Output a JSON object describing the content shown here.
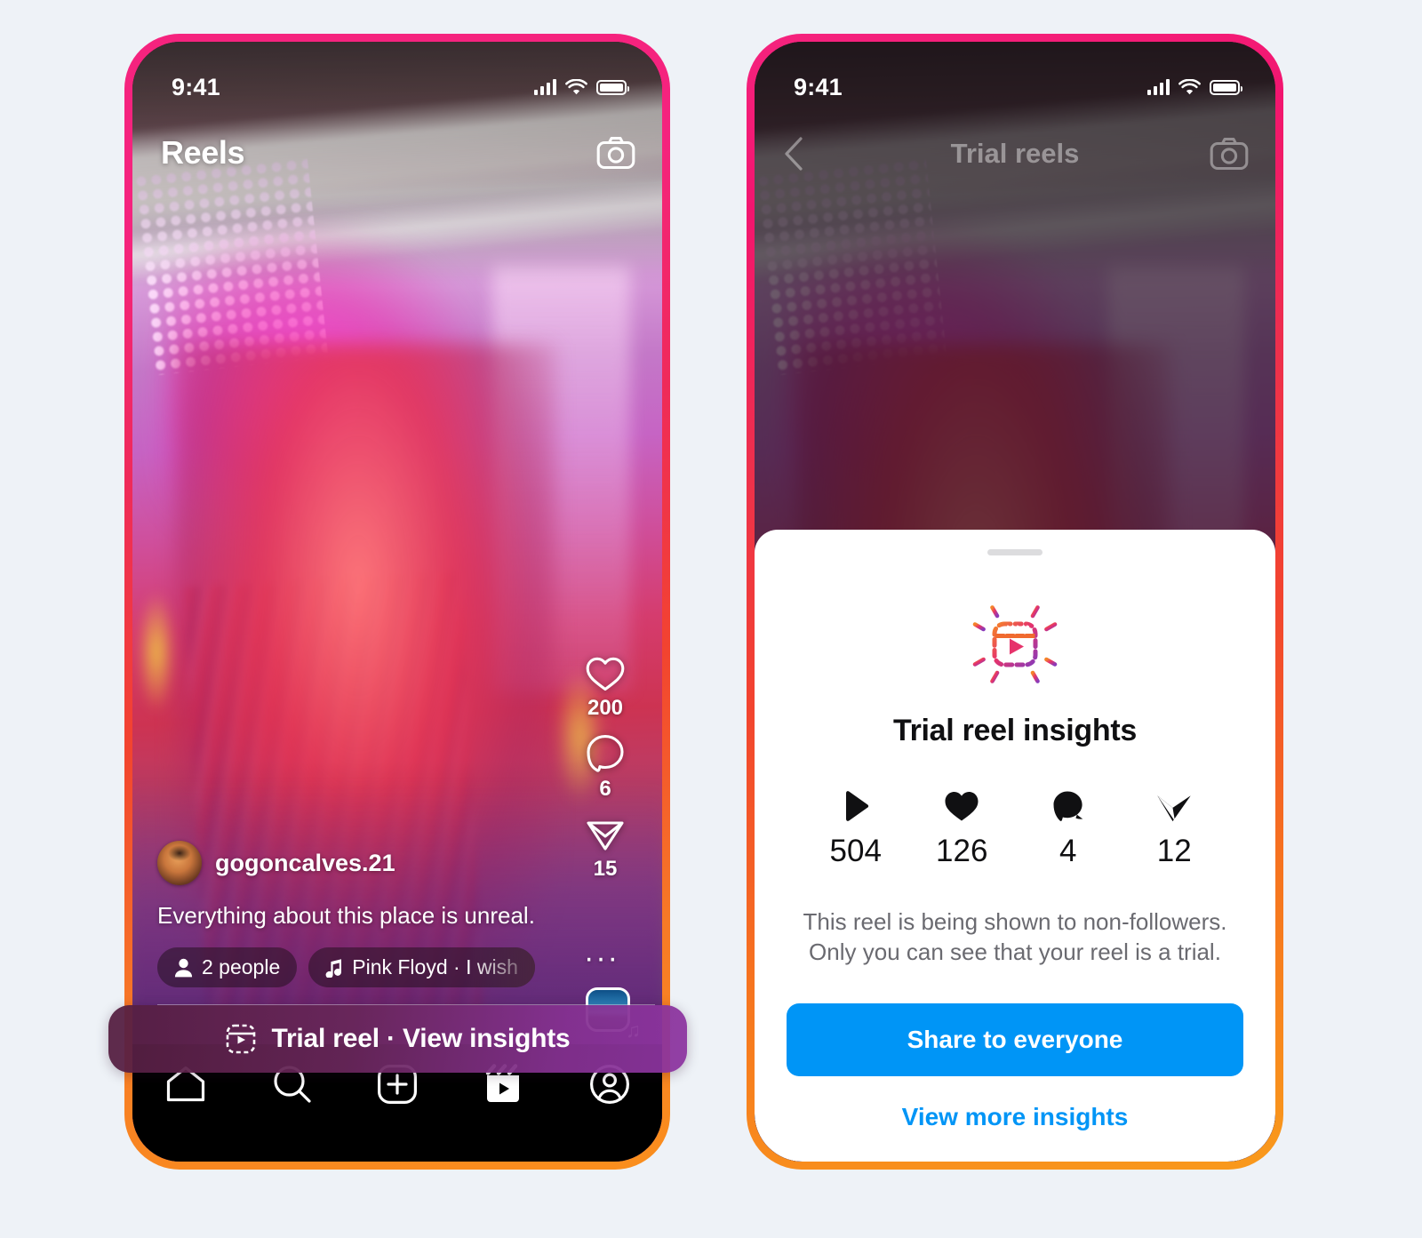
{
  "background_color": "#eef2f7",
  "accent_colors": {
    "instagram_blue": "#0095f6",
    "frame_gradient_top": "#f5237e",
    "frame_gradient_bottom": "#fa8f1d",
    "banner_purple": "#85319 1"
  },
  "phone_a": {
    "status_bar": {
      "time": "9:41",
      "signal_icon": "cellular-signal-icon",
      "wifi_icon": "wifi-icon",
      "battery_icon": "battery-icon"
    },
    "top_bar": {
      "title": "Reels",
      "camera_icon": "camera-icon"
    },
    "action_rail": [
      {
        "icon": "heart-icon",
        "name": "like-button",
        "count": "200"
      },
      {
        "icon": "comment-icon",
        "name": "comment-button",
        "count": "6"
      },
      {
        "icon": "share-icon",
        "name": "share-button",
        "count": "15"
      }
    ],
    "more_options": "···",
    "audio_thumbnail": {
      "icon": "audio-track-thumbnail",
      "note_glyph": "♫"
    },
    "post": {
      "username": "gogoncalves.21",
      "avatar": "user-avatar",
      "caption": "Everything about this place is unreal.",
      "tags": [
        {
          "icon": "person-icon",
          "label": "2 people"
        },
        {
          "icon": "music-note-icon",
          "label": "Pink Floyd · I wish"
        }
      ]
    },
    "trial_banner": {
      "icon": "trial-reel-icon",
      "label": "Trial reel · View insights"
    },
    "tab_bar": [
      {
        "name": "home",
        "icon": "home-icon"
      },
      {
        "name": "search",
        "icon": "search-icon"
      },
      {
        "name": "create",
        "icon": "plus-square-icon"
      },
      {
        "name": "reels",
        "icon": "reels-icon"
      },
      {
        "name": "profile",
        "icon": "profile-icon"
      }
    ]
  },
  "phone_b": {
    "status_bar": {
      "time": "9:41",
      "signal_icon": "cellular-signal-icon",
      "wifi_icon": "wifi-icon",
      "battery_icon": "battery-icon"
    },
    "top_bar": {
      "back_icon": "chevron-left-icon",
      "title": "Trial reels",
      "camera_icon": "camera-icon"
    },
    "sheet": {
      "grabber": "sheet-drag-handle",
      "hero_icon": "trial-reel-burst-icon",
      "title": "Trial reel insights",
      "stats": [
        {
          "icon": "play-icon",
          "name": "views",
          "value": "504"
        },
        {
          "icon": "heart-filled-icon",
          "name": "likes",
          "value": "126"
        },
        {
          "icon": "comment-filled-icon",
          "name": "comments",
          "value": "4"
        },
        {
          "icon": "share-filled-icon",
          "name": "shares",
          "value": "12"
        }
      ],
      "description_line_1": "This reel is being shown to non-followers.",
      "description_line_2": "Only you can see that your reel is a trial.",
      "primary_button": "Share to everyone",
      "secondary_link": "View more insights"
    }
  }
}
